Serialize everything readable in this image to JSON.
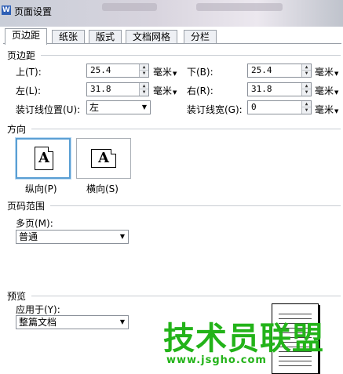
{
  "window": {
    "title": "页面设置",
    "app_icon": "W"
  },
  "tabs": [
    {
      "label": "页边距",
      "active": true
    },
    {
      "label": "纸张"
    },
    {
      "label": "版式"
    },
    {
      "label": "文档网格"
    },
    {
      "label": "分栏"
    }
  ],
  "margins": {
    "section_title": "页边距",
    "top": {
      "label": "上(T):",
      "value": "25.4",
      "unit": "毫米"
    },
    "bottom": {
      "label": "下(B):",
      "value": "25.4",
      "unit": "毫米"
    },
    "left": {
      "label": "左(L):",
      "value": "31.8",
      "unit": "毫米"
    },
    "right": {
      "label": "右(R):",
      "value": "31.8",
      "unit": "毫米"
    },
    "gutter_position": {
      "label": "装订线位置(U):",
      "value": "左"
    },
    "gutter_width": {
      "label": "装订线宽(G):",
      "value": "0",
      "unit": "毫米"
    }
  },
  "orientation": {
    "section_title": "方向",
    "portrait_label": "纵向(P)",
    "landscape_label": "横向(S)",
    "icon_letter": "A",
    "selected": "portrait"
  },
  "page_range": {
    "section_title": "页码范围",
    "multiple_label": "多页(M):",
    "multiple_value": "普通"
  },
  "preview": {
    "section_title": "预览",
    "apply_to_label": "应用于(Y):",
    "apply_to_value": "整篇文档"
  },
  "watermark": {
    "text": "技术员联盟",
    "url": "www.jsgho.com",
    "color": "#23b319"
  }
}
